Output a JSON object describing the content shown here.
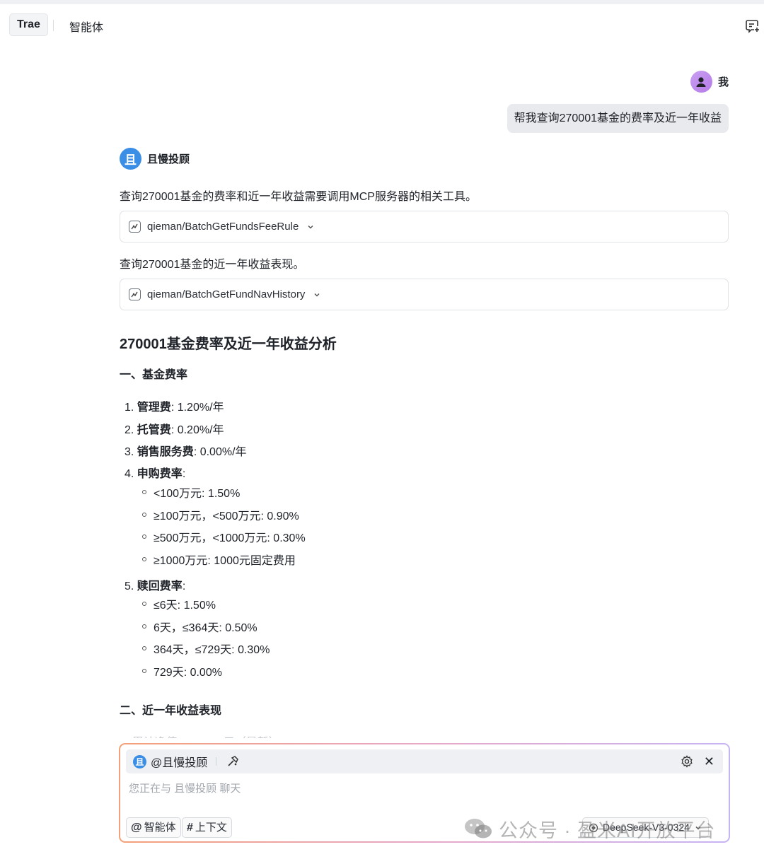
{
  "tabs": {
    "trae": "Trae",
    "agent": "智能体"
  },
  "user": {
    "name": "我",
    "message": "帮我查询270001基金的费率及近一年收益"
  },
  "agent": {
    "avatar_char": "且",
    "name": "且慢投顾",
    "intro": "查询270001基金的费率和近一年收益需要调用MCP服务器的相关工具。",
    "tool1": "qieman/BatchGetFundsFeeRule",
    "intro2": "查询270001基金的近一年收益表现。",
    "tool2": "qieman/BatchGetFundNavHistory"
  },
  "answer": {
    "title": "270001基金费率及近一年收益分析",
    "section1": "一、基金费率",
    "items": [
      {
        "num": "1.",
        "label": "管理费",
        "value": ": 1.20%/年"
      },
      {
        "num": "2.",
        "label": "托管费",
        "value": ": 0.20%/年"
      },
      {
        "num": "3.",
        "label": "销售服务费",
        "value": ": 0.00%/年"
      },
      {
        "num": "4.",
        "label": "申购费率",
        "value": ":"
      },
      {
        "num": "5.",
        "label": "赎回费率",
        "value": ":"
      }
    ],
    "purchase_rates": [
      "<100万元: 1.50%",
      "≥100万元，<500万元: 0.90%",
      "≥500万元，<1000万元: 0.30%",
      "≥1000万元: 1000元固定费用"
    ],
    "redeem_rates": [
      "≤6天: 1.50%",
      "6天，≤364天: 0.50%",
      "364天，≤729天: 0.30%",
      "729天: 0.00%"
    ],
    "section2": "二、近一年收益表现",
    "faded_line": "1. 累计净值：1.1234元（最新）"
  },
  "composer": {
    "avatar_char": "且",
    "mention": "@且慢投顾",
    "placeholder": "您正在与 且慢投顾 聊天",
    "chip_agent_sym": "@",
    "chip_agent": "智能体",
    "chip_context_sym": "#",
    "chip_context": "上下文",
    "model": "DeepSeek-V3-0324"
  },
  "watermark": "公众号 · 盈米AI开放平台",
  "colors": {
    "accent_blue": "#3a8ee6",
    "user_avatar": "#b57be8",
    "bubble": "#e8eaed"
  },
  "icons": [
    "new-chat-icon",
    "person-icon",
    "tool-icon",
    "chevron-down-icon",
    "tools-icon",
    "gear-icon",
    "close-icon",
    "wechat-icon"
  ]
}
